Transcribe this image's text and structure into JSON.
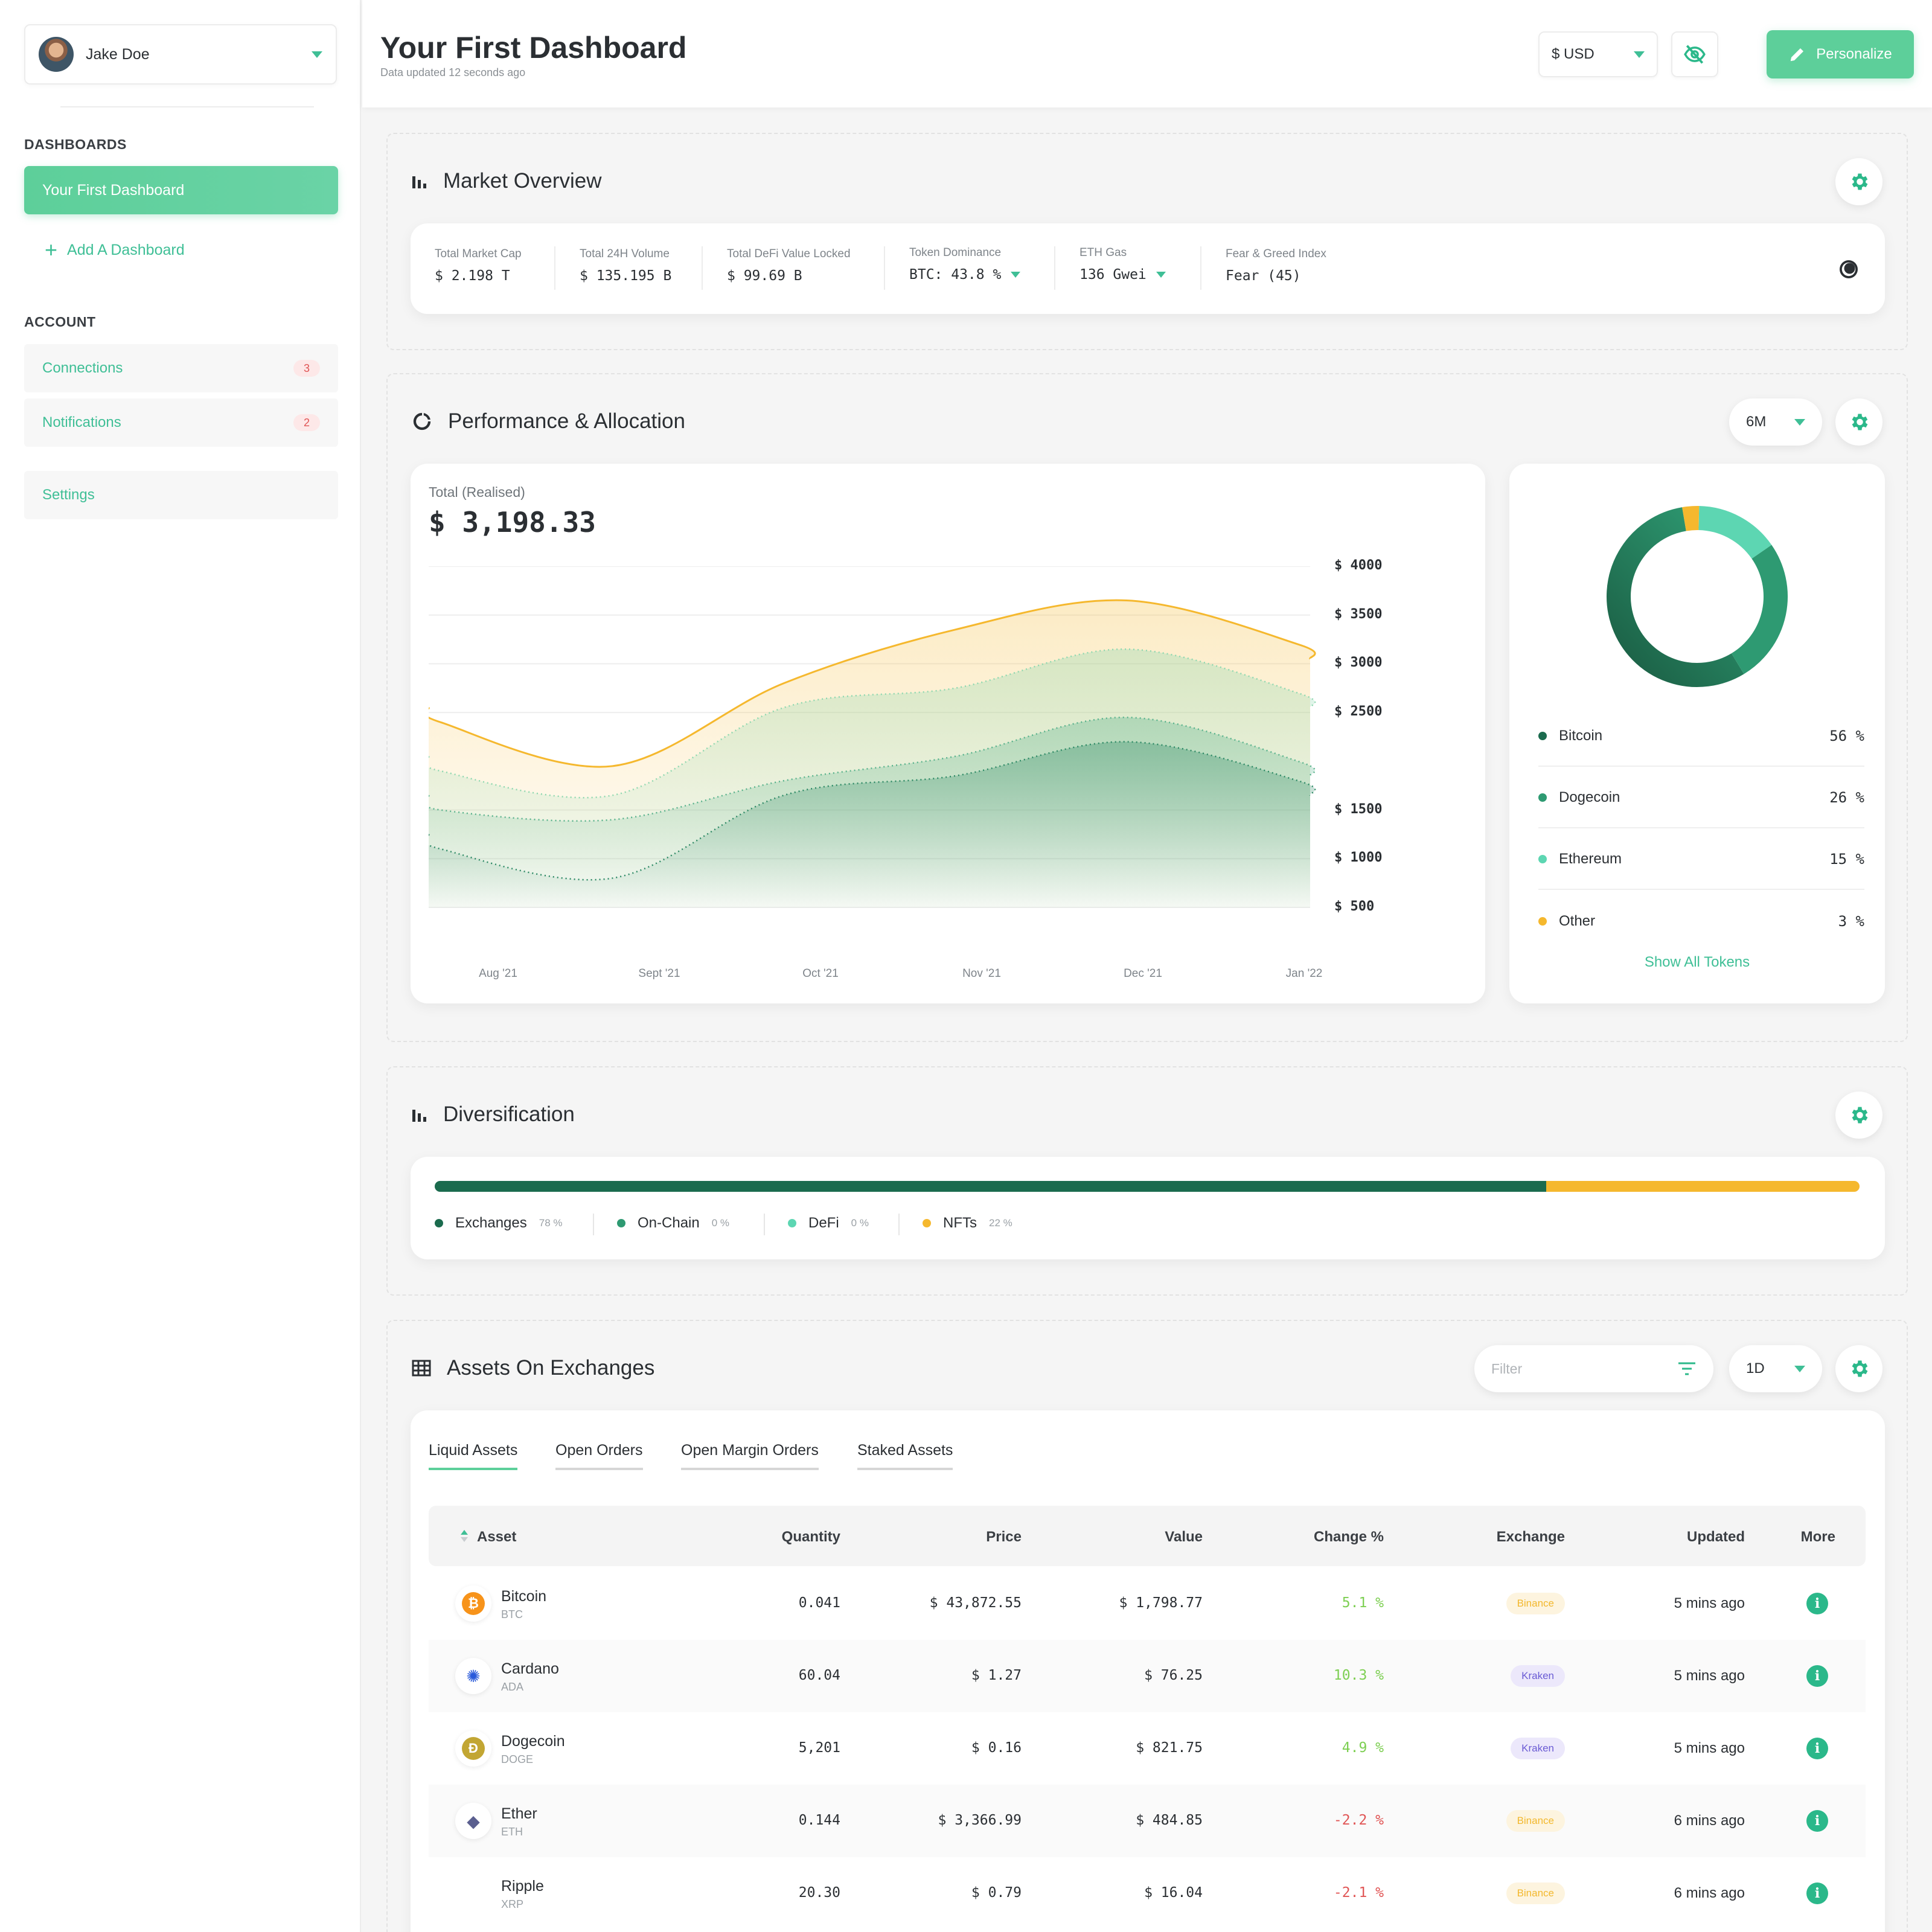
{
  "sidebar": {
    "user_name": "Jake Doe",
    "dashboards_heading": "DASHBOARDS",
    "active_dashboard": "Your First Dashboard",
    "add_dashboard": "Add A Dashboard",
    "account_heading": "ACCOUNT",
    "connections": {
      "label": "Connections",
      "count": "3"
    },
    "notifications": {
      "label": "Notifications",
      "count": "2"
    },
    "settings": "Settings"
  },
  "header": {
    "title": "Your First Dashboard",
    "subtitle": "Data updated 12 seconds ago",
    "currency": "$ USD",
    "personalize": "Personalize"
  },
  "market_overview": {
    "title": "Market Overview",
    "items": [
      {
        "label": "Total Market Cap",
        "value": "$ 2.198 T"
      },
      {
        "label": "Total 24H Volume",
        "value": "$ 135.195 B"
      },
      {
        "label": "Total DeFi Value Locked",
        "value": "$ 99.69 B"
      },
      {
        "label": "Token Dominance",
        "value": "BTC: 43.8 %"
      },
      {
        "label": "ETH Gas",
        "value": "136 Gwei"
      },
      {
        "label": "Fear & Greed Index",
        "value": "Fear (45)"
      }
    ]
  },
  "performance": {
    "title": "Performance & Allocation",
    "period": "6M",
    "total_label": "Total (Realised)",
    "total_value": "$ 3,198.33",
    "show_all": "Show All Tokens"
  },
  "allocation": [
    {
      "name": "Bitcoin",
      "pct": "56 %",
      "color": "#1b6b4e"
    },
    {
      "name": "Dogecoin",
      "pct": "26 %",
      "color": "#2e9a72"
    },
    {
      "name": "Ethereum",
      "pct": "15 %",
      "color": "#5dd6b2"
    },
    {
      "name": "Other",
      "pct": "3 %",
      "color": "#f5b82e"
    }
  ],
  "chart_data": [
    {
      "type": "area",
      "x": [
        "Aug '21",
        "Sept '21",
        "Oct '21",
        "Nov '21",
        "Dec '21",
        "Jan '22"
      ],
      "y_tick_labels": [
        "$ 4000",
        "$ 3500",
        "$ 3000",
        "$ 2500",
        "$ 1500",
        "$ 1000",
        "$ 500"
      ],
      "series": [
        {
          "values": [
            2400,
            1950,
            2800,
            3350,
            3650,
            3200
          ],
          "color": "#f5b82e"
        },
        {
          "values": [
            1900,
            1650,
            2550,
            2750,
            3150,
            2700
          ],
          "color": "#8fd8b0"
        },
        {
          "values": [
            1500,
            1400,
            1800,
            2050,
            2450,
            2000
          ],
          "color": "#5ab38d"
        },
        {
          "values": [
            1100,
            800,
            1650,
            1850,
            2200,
            1800
          ],
          "color": "#2e8a66"
        }
      ]
    },
    {
      "type": "pie",
      "categories": [
        "Bitcoin",
        "Dogecoin",
        "Ethereum",
        "Other"
      ],
      "values": [
        56,
        26,
        15,
        3
      ],
      "colors": [
        "#1b6b4e",
        "#2e9a72",
        "#5dd6b2",
        "#f5b82e"
      ]
    }
  ],
  "diversification": {
    "title": "Diversification",
    "items": [
      {
        "name": "Exchanges",
        "pct": "78 %",
        "value": 78,
        "color": "#1b6b4e"
      },
      {
        "name": "On-Chain",
        "pct": "0 %",
        "value": 0,
        "color": "#2e9a72"
      },
      {
        "name": "DeFi",
        "pct": "0 %",
        "value": 0,
        "color": "#5dd6b2"
      },
      {
        "name": "NFTs",
        "pct": "22 %",
        "value": 22,
        "color": "#f5b82e"
      }
    ]
  },
  "assets": {
    "title": "Assets On Exchanges",
    "filter_placeholder": "Filter",
    "period": "1D",
    "tabs": [
      "Liquid Assets",
      "Open Orders",
      "Open Margin Orders",
      "Staked Assets"
    ],
    "columns": [
      "Asset",
      "Quantity",
      "Price",
      "Value",
      "Change %",
      "Exchange",
      "Updated",
      "More"
    ],
    "rows": [
      {
        "name": "Bitcoin",
        "symbol": "BTC",
        "quantity": "0.041",
        "price": "$ 43,872.55",
        "value": "$ 1,798.77",
        "change": "5.1 %",
        "exchange": "Binance",
        "updated": "5 mins ago"
      },
      {
        "name": "Cardano",
        "symbol": "ADA",
        "quantity": "60.04",
        "price": "$ 1.27",
        "value": "$ 76.25",
        "change": "10.3 %",
        "exchange": "Kraken",
        "updated": "5 mins ago"
      },
      {
        "name": "Dogecoin",
        "symbol": "DOGE",
        "quantity": "5,201",
        "price": "$ 0.16",
        "value": "$ 821.75",
        "change": "4.9 %",
        "exchange": "Kraken",
        "updated": "5 mins ago"
      },
      {
        "name": "Ether",
        "symbol": "ETH",
        "quantity": "0.144",
        "price": "$ 3,366.99",
        "value": "$ 484.85",
        "change": "-2.2 %",
        "exchange": "Binance",
        "updated": "6 mins ago"
      },
      {
        "name": "Ripple",
        "symbol": "XRP",
        "quantity": "20.30",
        "price": "$ 0.79",
        "value": "$ 16.04",
        "change": "-2.1 %",
        "exchange": "Binance",
        "updated": "6 mins ago"
      }
    ]
  },
  "icons": {
    "coin_btc": "₿",
    "coin_doge": "Ð",
    "coin_ada": "✺",
    "coin_eth": "◆",
    "info": "i"
  }
}
